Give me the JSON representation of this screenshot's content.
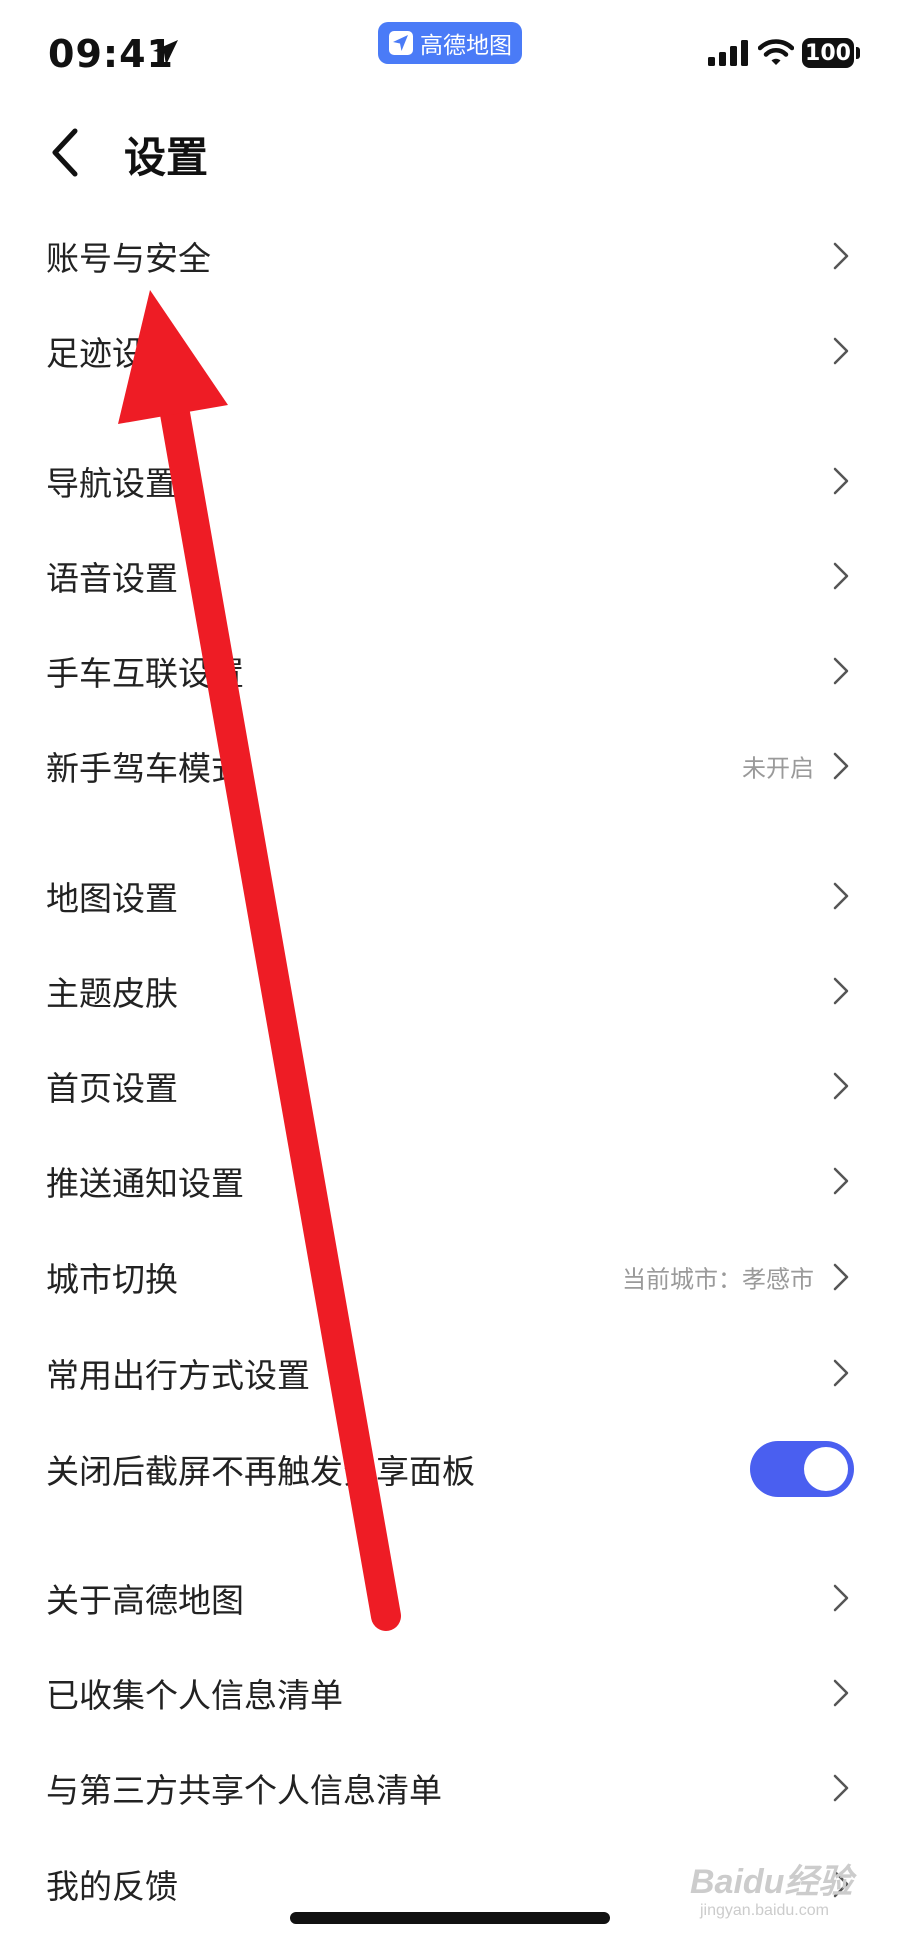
{
  "status_bar": {
    "time": "09:41",
    "app_pill_label": "高德地图",
    "battery": "100"
  },
  "header": {
    "title": "设置"
  },
  "settings": {
    "items": [
      {
        "label": "账号与安全",
        "value": ""
      },
      {
        "label": "足迹设置",
        "value": ""
      },
      {
        "label": "导航设置",
        "value": ""
      },
      {
        "label": "语音设置",
        "value": ""
      },
      {
        "label": "手车互联设置",
        "value": ""
      },
      {
        "label": "新手驾车模式",
        "value": "未开启"
      },
      {
        "label": "地图设置",
        "value": ""
      },
      {
        "label": "主题皮肤",
        "value": ""
      },
      {
        "label": "首页设置",
        "value": ""
      },
      {
        "label": "推送通知设置",
        "value": ""
      },
      {
        "label": "城市切换",
        "value": "当前城市：孝感市"
      },
      {
        "label": "常用出行方式设置",
        "value": ""
      },
      {
        "label": "关闭后截屏不再触发分享面板",
        "toggle_on": true
      },
      {
        "label": "关于高德地图",
        "value": ""
      },
      {
        "label": "已收集个人信息清单",
        "value": ""
      },
      {
        "label": "与第三方共享个人信息清单",
        "value": ""
      },
      {
        "label": "我的反馈",
        "value": ""
      }
    ]
  },
  "watermark": {
    "brand": "Baidu经验",
    "sub": "jingyan.baidu.com"
  },
  "colors": {
    "toggle_on": "#4a5ff0",
    "app_pill": "#4a7bf7",
    "annotation_arrow": "#ee1c25"
  }
}
